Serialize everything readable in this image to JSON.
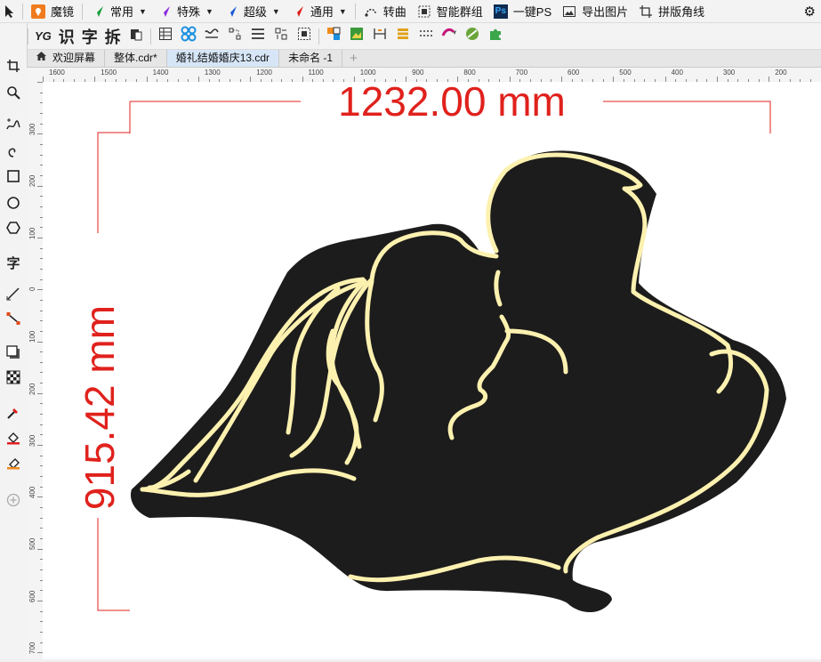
{
  "toolbar1": {
    "brand": "魔镜",
    "menus": [
      {
        "label": "常用",
        "color": "#1a9d3c"
      },
      {
        "label": "特殊",
        "color": "#8b2be2"
      },
      {
        "label": "超级",
        "color": "#1e5bd6"
      },
      {
        "label": "通用",
        "color": "#e01f1f"
      }
    ],
    "turn_curve": "转曲",
    "smart_group": "智能群组",
    "ps_icon": "Ps",
    "one_key_ps": "一键PS",
    "export_image": "导出图片",
    "layout_corner": "拼版角线"
  },
  "toolbar2": {
    "logo": "YG",
    "recognize": "识",
    "char": "字",
    "split": "拆"
  },
  "tabs": [
    {
      "label": "欢迎屏幕",
      "active": false
    },
    {
      "label": "整体.cdr*",
      "active": false
    },
    {
      "label": "婚礼结婚婚庆13.cdr",
      "active": true
    },
    {
      "label": "未命名 -1",
      "active": false
    }
  ],
  "toolbox": {
    "text_tool": "字"
  },
  "ruler": {
    "horizontal": [
      "1600",
      "1500",
      "1400",
      "1300",
      "1200",
      "1100",
      "1000",
      "900",
      "800",
      "700",
      "600",
      "500",
      "400",
      "300",
      "200"
    ],
    "vertical": [
      "300",
      "200",
      "100",
      "0",
      "100",
      "200",
      "300",
      "400",
      "500",
      "600",
      "700"
    ]
  },
  "canvas": {
    "width_dimension": "1232.00 mm",
    "height_dimension": "915.42 mm",
    "dimension_color": "#e0211c",
    "artwork_fill": "#1c1c1c",
    "artwork_line": "#fdf1b0"
  }
}
